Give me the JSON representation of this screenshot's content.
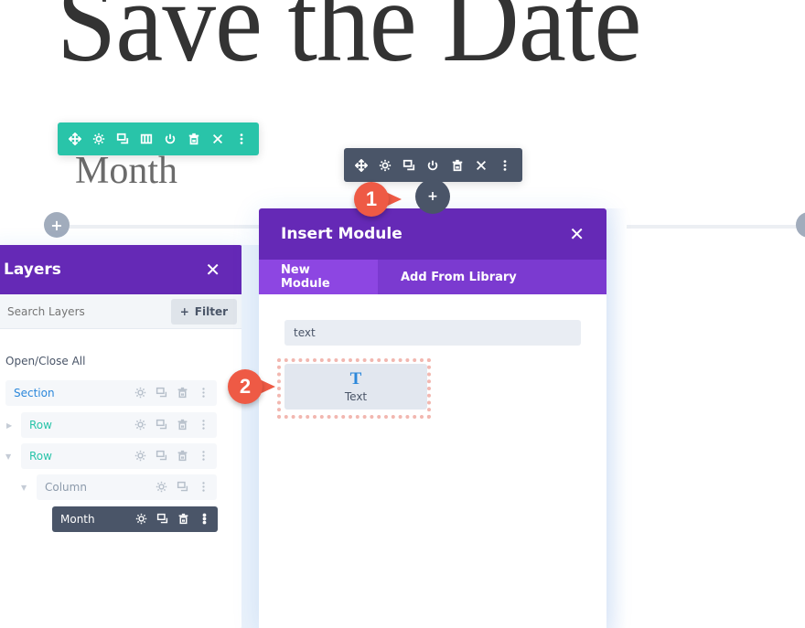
{
  "page": {
    "hero_title": "Save the Date",
    "month_heading": "Month"
  },
  "row_toolbar": {
    "buttons": [
      "move-icon",
      "gear-icon",
      "duplicate-icon",
      "columns-icon",
      "power-icon",
      "trash-icon",
      "close-icon",
      "more-icon"
    ]
  },
  "module_toolbar": {
    "buttons": [
      "move-icon",
      "gear-icon",
      "duplicate-icon",
      "power-icon",
      "trash-icon",
      "close-icon",
      "more-icon"
    ]
  },
  "add_buttons": {
    "plus": "+"
  },
  "badges": {
    "step1": "1",
    "step2": "2",
    "color": "#ee5a45"
  },
  "layers": {
    "title": "Layers",
    "close": "✕",
    "search_placeholder": "Search Layers",
    "filter_label": "Filter",
    "filter_icon": "+",
    "open_close_all": "Open/Close All",
    "items": [
      {
        "label": "Section",
        "type": "section",
        "color": "#2b87da"
      },
      {
        "label": "Row",
        "type": "row",
        "color": "#29c4a9",
        "expanded": false
      },
      {
        "label": "Row",
        "type": "row",
        "color": "#29c4a9",
        "expanded": true
      },
      {
        "label": "Column",
        "type": "column",
        "color": "#8c9aab",
        "expanded": true
      },
      {
        "label": "Month",
        "type": "module",
        "active": true
      }
    ]
  },
  "insert_module": {
    "title": "Insert Module",
    "close": "✕",
    "tabs": [
      {
        "label": "New Module",
        "active": true
      },
      {
        "label": "Add From Library",
        "active": false
      }
    ],
    "search_value": "text",
    "results": [
      {
        "label": "Text",
        "icon": "T"
      }
    ]
  },
  "colors": {
    "purple_header": "#6529b6",
    "purple_tabs": "#7b3ad0",
    "teal": "#29c4a9",
    "slate": "#4a5568",
    "blue": "#2b87da"
  }
}
